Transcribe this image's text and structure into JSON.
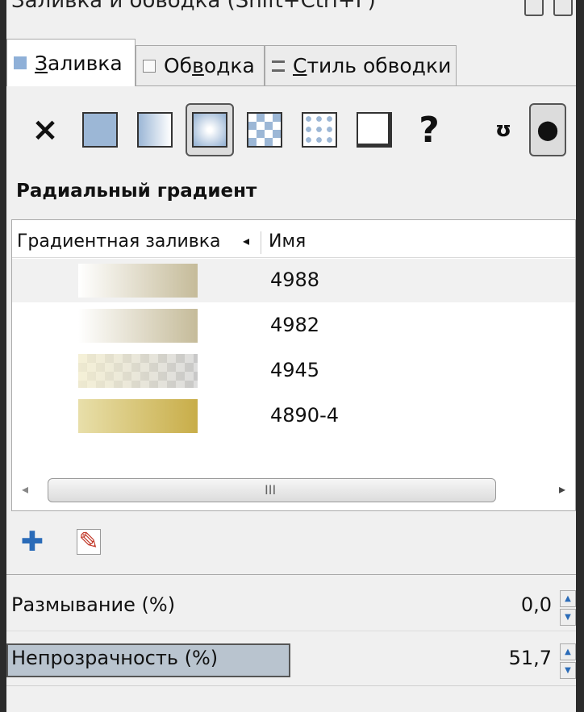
{
  "window": {
    "title": "Заливка и обводка (Shift+Ctrl+F)"
  },
  "tabs": [
    {
      "label": "Заливка",
      "underline": "З",
      "rest": "аливка",
      "active": true
    },
    {
      "label": "Обводка",
      "pre": "Об",
      "underline": "в",
      "rest": "одка",
      "active": false
    },
    {
      "label": "Стиль обводки",
      "underline": "С",
      "rest": "тиль обводки",
      "active": false
    }
  ],
  "fill_types": [
    {
      "name": "none",
      "icon": "×"
    },
    {
      "name": "flat"
    },
    {
      "name": "linear"
    },
    {
      "name": "radial",
      "selected": true
    },
    {
      "name": "pattern"
    },
    {
      "name": "swatch"
    },
    {
      "name": "unset"
    },
    {
      "name": "unknown",
      "icon": "?"
    }
  ],
  "fill_rule": {
    "evenodd_icon": "ʊ",
    "nonzero_icon": "⬤"
  },
  "section_heading": "Радиальный градиент",
  "gradient_list": {
    "col_gradient": "Градиентная заливка",
    "col_name": "Имя",
    "sort_arrow": "◂",
    "rows": [
      {
        "name": "4988",
        "start": "#ffffff",
        "end": "#c5bb99",
        "checker": false,
        "selected": true
      },
      {
        "name": "4982",
        "start": "#ffffff",
        "end": "#c5bb99",
        "checker": false,
        "selected": false
      },
      {
        "name": "4945",
        "start": "#f6f0d0",
        "end": "#bdbdbd",
        "checker": true,
        "selected": false
      },
      {
        "name": "4890-4",
        "start": "#e8dfaa",
        "end": "#c8ad48",
        "checker": false,
        "selected": false
      }
    ],
    "scroll_left": "◂",
    "scroll_right": "▸",
    "scroll_grip": "III"
  },
  "actions": {
    "add_icon": "✚",
    "edit_icon": "✎"
  },
  "blur": {
    "label": "Размывание (%)",
    "value": "0,0"
  },
  "opacity": {
    "label": "Непрозрачность (%)",
    "value": "51,7",
    "level": 0.517
  },
  "colors": {
    "accent": "#2a6bb8",
    "flat": "#9cb7d6",
    "panel": "#f0f0f0"
  }
}
